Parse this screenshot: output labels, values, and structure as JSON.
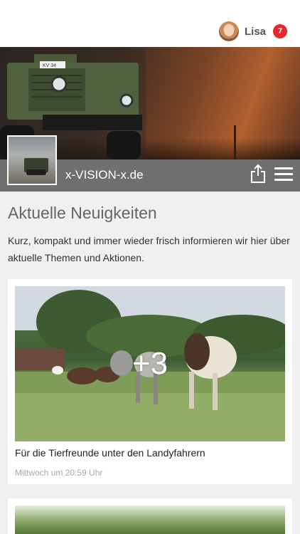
{
  "header": {
    "username": "Lisa",
    "notification_count": "7"
  },
  "banner": {
    "site_title": "x-VISION-x.de",
    "plate_text": "KV 34"
  },
  "news": {
    "heading": "Aktuelle Neuigkeiten",
    "intro": "Kurz, kompakt und immer wieder frisch informieren wir hier über aktuelle Themen und Aktionen."
  },
  "posts": [
    {
      "more_images": "+3",
      "caption": "Für die Tierfreunde unter den Landyfahrern",
      "time": "Mittwoch um 20:59 Uhr"
    }
  ],
  "colors": {
    "badge": "#e8262b",
    "titlebar": "#646464",
    "background": "#f0f0f0"
  },
  "icons": [
    "avatar",
    "share-icon",
    "hamburger-menu-icon"
  ]
}
